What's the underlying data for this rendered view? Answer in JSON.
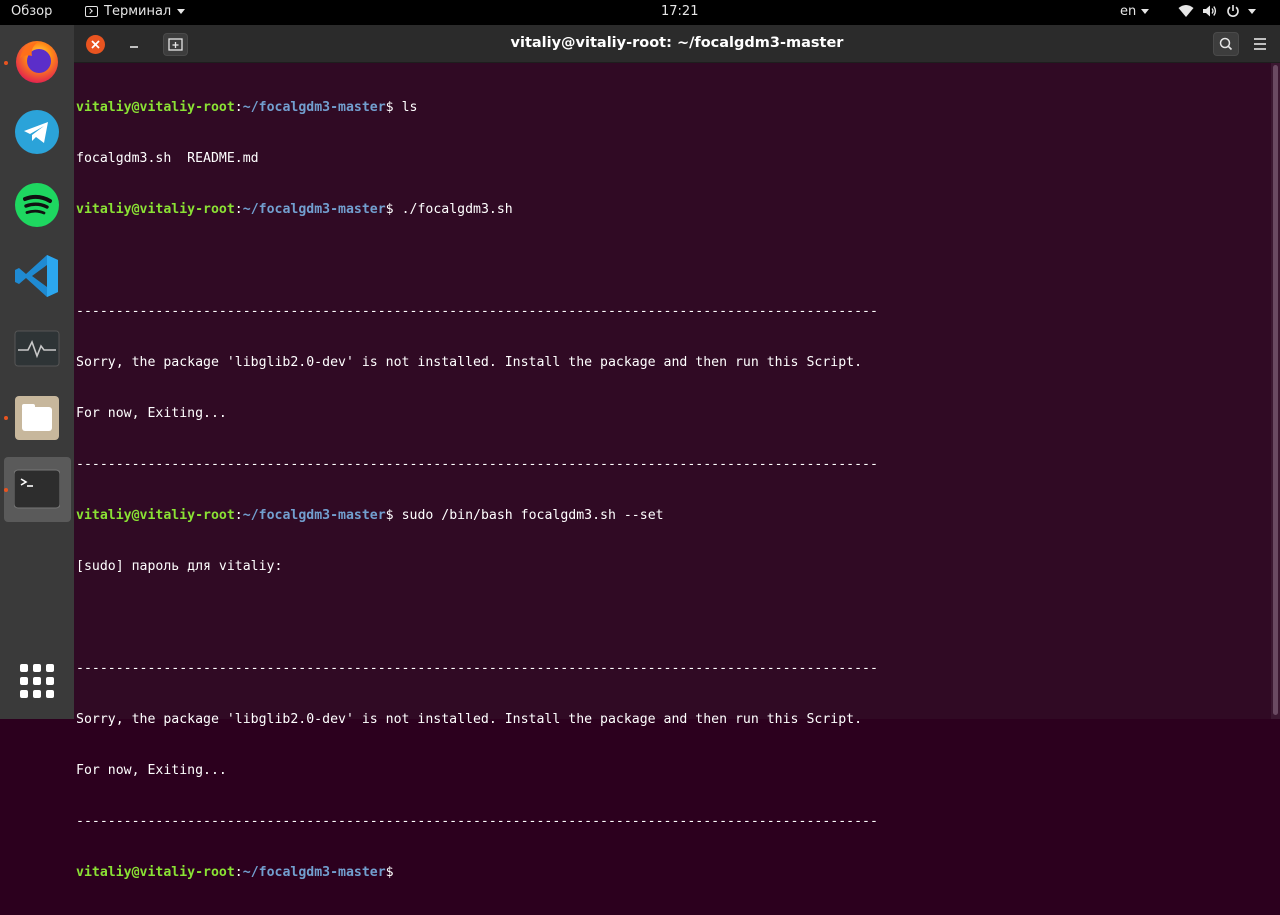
{
  "topbar": {
    "overview": "Обзор",
    "app_menu": "Терминал",
    "clock": "17:21",
    "lang": "en"
  },
  "dock": {
    "apps": [
      "firefox-icon",
      "telegram-icon",
      "spotify-icon",
      "vscode-icon",
      "system-monitor-icon",
      "files-icon",
      "terminal-icon",
      "show-apps-icon"
    ]
  },
  "window": {
    "title": "vitaliy@vitaliy-root: ~/focalgdm3-master"
  },
  "colors": {
    "accent": "#e95420",
    "terminal_bg": "#300a24",
    "prompt_user": "#8ae234",
    "prompt_path": "#729fcf"
  },
  "terminal": {
    "prompt_user": "vitaliy@vitaliy-root",
    "prompt_sep": ":",
    "prompt_path": "~/focalgdm3-master",
    "prompt_dollar": "$",
    "cmd1": " ls",
    "out1": "focalgdm3.sh  README.md",
    "cmd2": " ./focalgdm3.sh",
    "blank": "",
    "dashes": "-----------------------------------------------------------------------------------------------------",
    "sorry": "Sorry, the package 'libglib2.0-dev' is not installed. Install the package and then run this Script.",
    "exiting": "For now, Exiting...",
    "cmd3": " sudo /bin/bash focalgdm3.sh --set",
    "sudo_prompt": "[sudo] пароль для vitaliy:",
    "cmd4": ""
  }
}
